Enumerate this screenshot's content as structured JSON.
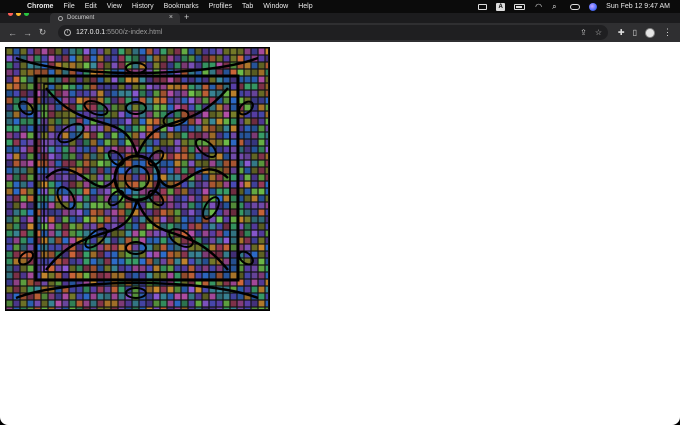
{
  "menubar": {
    "app_name": "Chrome",
    "items": [
      "File",
      "Edit",
      "View",
      "History",
      "Bookmarks",
      "Profiles",
      "Tab",
      "Window",
      "Help"
    ],
    "status_icons": [
      "screen-mirroring-icon",
      "keyboard-input-icon",
      "battery-icon",
      "wifi-icon",
      "spotlight-search-icon",
      "control-center-icon",
      "siri-icon"
    ],
    "input_letter": "A",
    "clock": "Sun Feb 12  9:47 AM"
  },
  "tab": {
    "title": "Document",
    "close_glyph": "×",
    "new_tab_glyph": "+"
  },
  "toolbar": {
    "url_host": "127.0.0.1",
    "url_path": ":5500/z-index.html",
    "icons": [
      "back-icon",
      "forward-icon",
      "reload-icon",
      "share-icon",
      "bookmark-star-icon",
      "extensions-icon",
      "side-panel-icon",
      "profile-icon",
      "menu-icon"
    ]
  },
  "content": {
    "image": "stained-glass-mosaic-image"
  },
  "colors": {
    "menubar_bg": "#0b0b0b",
    "toolbar_bg": "#2f2f31",
    "omnibox_bg": "#1f1f21",
    "page_bg": "#ffffff"
  }
}
